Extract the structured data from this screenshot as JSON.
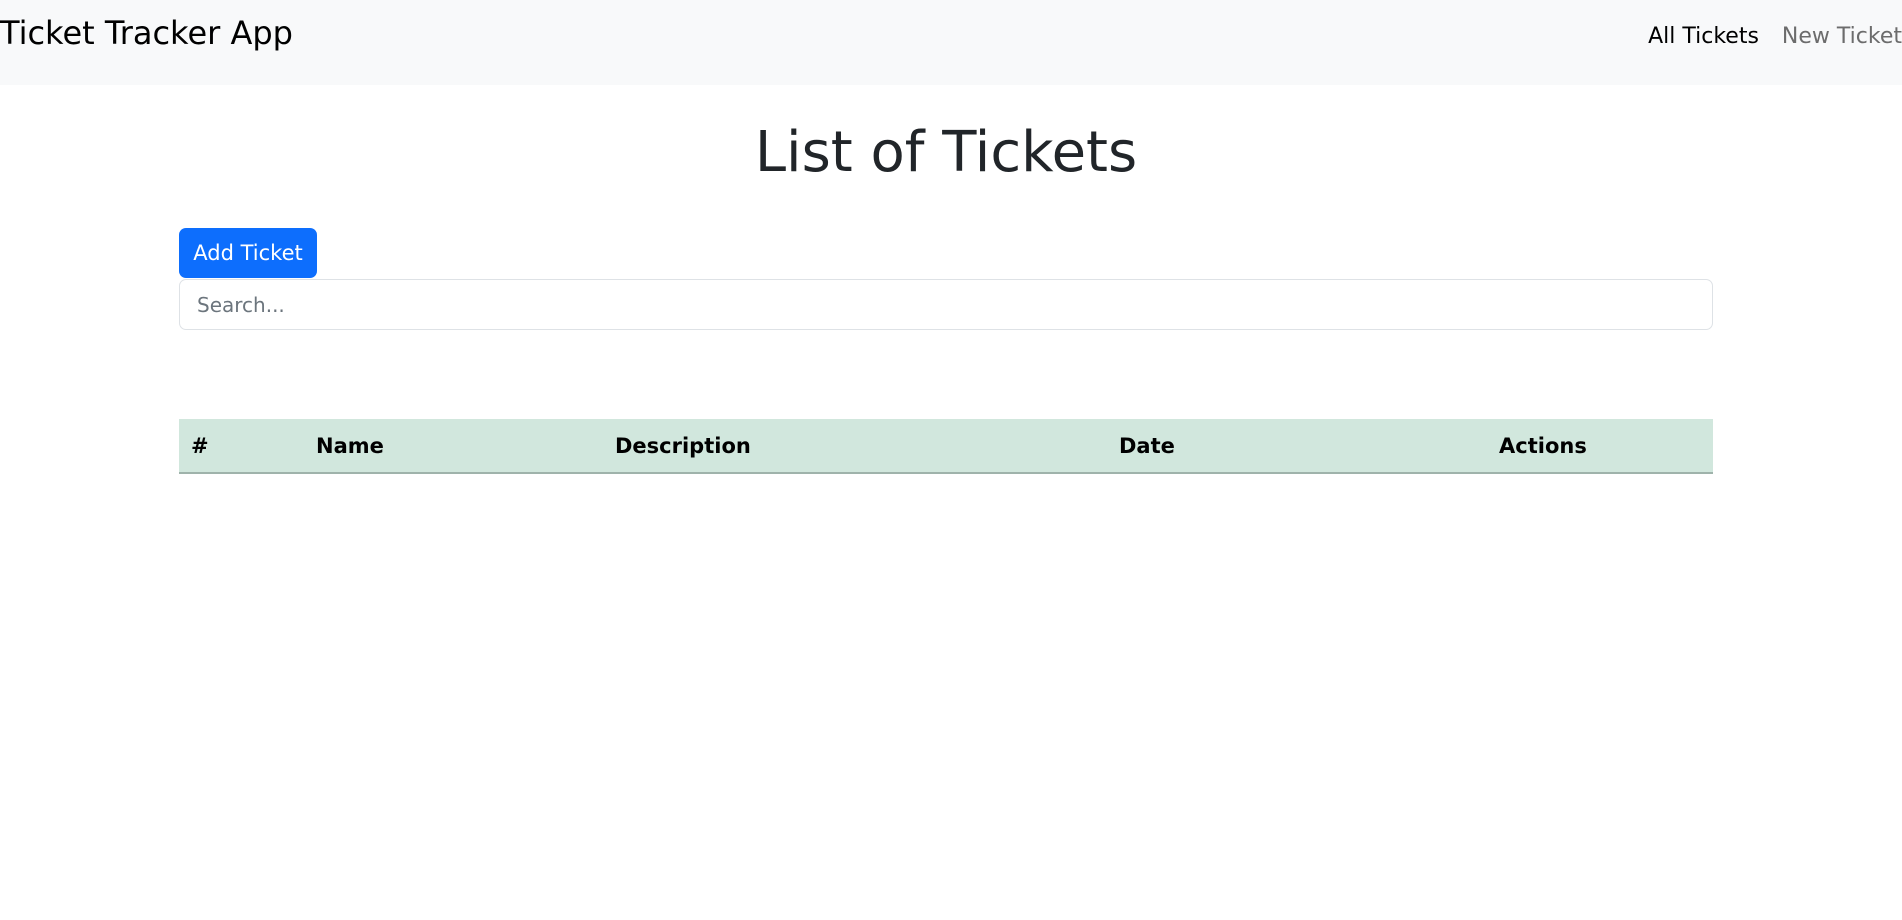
{
  "navbar": {
    "brand": "Ticket Tracker App",
    "links": [
      {
        "label": "All Tickets",
        "active": true
      },
      {
        "label": "New Ticket",
        "active": false
      }
    ]
  },
  "main": {
    "title": "List of Tickets",
    "add_button_label": "Add Ticket",
    "search": {
      "placeholder": "Search...",
      "value": ""
    },
    "table": {
      "headers": [
        "#",
        "Name",
        "Description",
        "Date",
        "Actions"
      ],
      "rows": []
    }
  },
  "colors": {
    "primary": "#0d6efd",
    "navbar_bg": "#f8f9fa",
    "table_header_bg": "#d1e7dd"
  }
}
